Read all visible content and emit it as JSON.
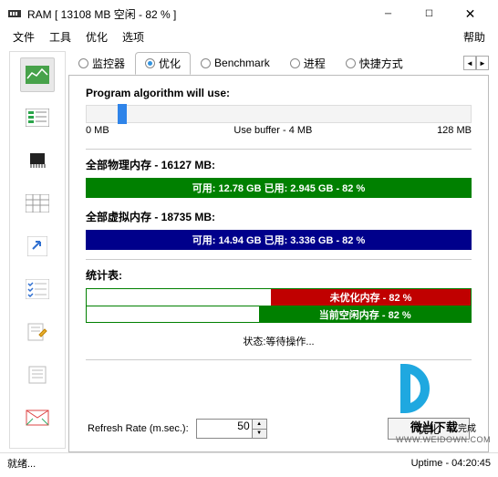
{
  "window": {
    "title": "RAM [ 13108 MB 空闲 - 82 % ]"
  },
  "menu": {
    "file": "文件",
    "tools": "工具",
    "optimize": "优化",
    "options": "选项",
    "help": "帮助"
  },
  "tabs": {
    "monitor": "监控器",
    "optimize": "优化",
    "benchmark": "Benchmark",
    "processes": "进程",
    "shortcuts": "快捷方式"
  },
  "panel": {
    "algo_title": "Program algorithm will use:",
    "slider": {
      "min": "0 MB",
      "mid": "Use buffer - 4 MB",
      "max": "128 MB"
    },
    "phys_label": "全部物理内存 - 16127 MB:",
    "phys_bar": "可用: 12.78 GB  已用: 2.945 GB - 82 %",
    "virt_label": "全部虚拟内存 - 18735 MB:",
    "virt_bar": "可用: 14.94 GB  已用: 3.336 GB - 82 %",
    "stats_label": "统计表:",
    "stat_unopt": "未优化内存 - 82 %",
    "stat_idle": "当前空闲内存 - 82 %",
    "status_text": "状态:等待操作...",
    "refresh_label": "Refresh Rate (m.sec.):",
    "refresh_value": "50",
    "optimize_btn": "优化"
  },
  "statusbar": {
    "left": "就绪...",
    "right": "Uptime - 04:20:45"
  },
  "watermark": {
    "name": "微当下载",
    "sub": "完成",
    "url": "WWW.WEIDOWN.COM"
  },
  "chart_data": [
    {
      "type": "bar",
      "title": "全部物理内存",
      "total_mb": 16127,
      "free_gb": 12.78,
      "used_gb": 2.945,
      "free_pct": 82
    },
    {
      "type": "bar",
      "title": "全部虚拟内存",
      "total_mb": 18735,
      "free_gb": 14.94,
      "used_gb": 3.336,
      "free_pct": 82
    },
    {
      "type": "bar",
      "title": "未优化内存",
      "pct": 82
    },
    {
      "type": "bar",
      "title": "当前空闲内存",
      "pct": 82
    }
  ]
}
